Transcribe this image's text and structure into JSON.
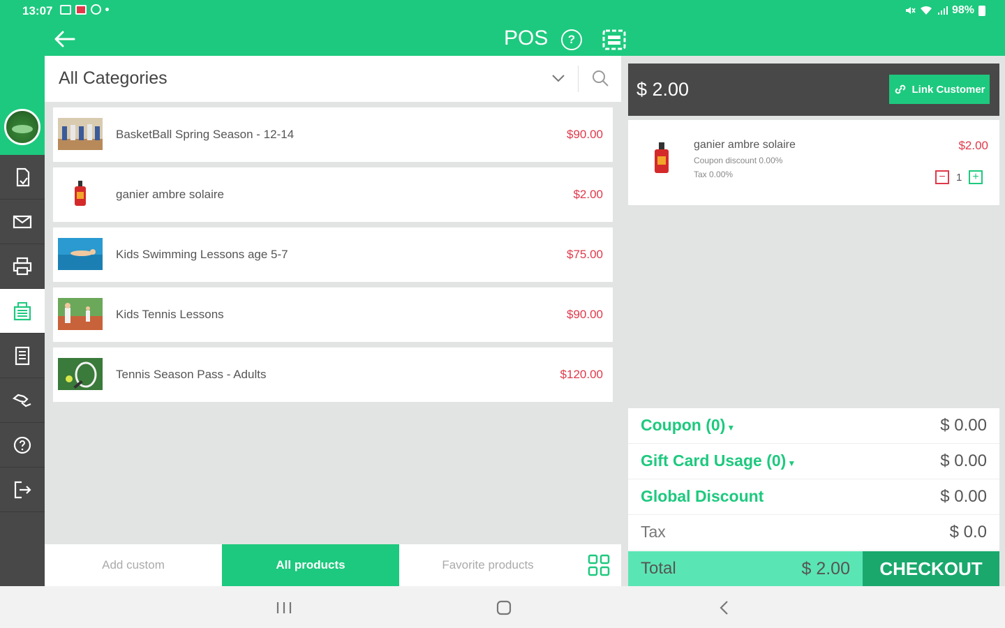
{
  "status_bar": {
    "time": "13:07",
    "battery": "98%"
  },
  "header": {
    "title": "POS",
    "icons": [
      "back-arrow-icon",
      "help-icon",
      "cash-register-icon"
    ],
    "help_glyph": "?"
  },
  "sidebar": {
    "items": [
      {
        "icon": "orders-icon"
      },
      {
        "icon": "mail-icon"
      },
      {
        "icon": "printer-icon"
      },
      {
        "icon": "register-icon",
        "active": true
      },
      {
        "icon": "reports-icon"
      },
      {
        "icon": "payments-icon"
      },
      {
        "icon": "help-icon"
      },
      {
        "icon": "logout-icon"
      }
    ]
  },
  "catalog": {
    "category": "All Categories",
    "products": [
      {
        "name": "BasketBall Spring Season - 12-14",
        "price": "$90.00"
      },
      {
        "name": "ganier ambre solaire",
        "price": "$2.00"
      },
      {
        "name": "Kids Swimming Lessons age 5-7",
        "price": "$75.00"
      },
      {
        "name": "Kids Tennis Lessons",
        "price": "$90.00"
      },
      {
        "name": "Tennis Season Pass - Adults",
        "price": "$120.00"
      }
    ],
    "tabs": {
      "add_custom": "Add custom",
      "all_products": "All products",
      "favorite_products": "Favorite products"
    }
  },
  "cart": {
    "header_total": "$ 2.00",
    "link_customer": "Link Customer",
    "item": {
      "name": "ganier ambre solaire",
      "coupon": "Coupon discount 0.00%",
      "tax": "Tax 0.00%",
      "price": "$2.00",
      "qty": "1",
      "minus": "−",
      "plus": "+"
    },
    "summary": {
      "coupon_label": "Coupon (0)",
      "coupon_value": "$ 0.00",
      "gift_label": "Gift Card Usage (0)",
      "gift_value": "$ 0.00",
      "global_label": "Global Discount",
      "global_value": "$ 0.00",
      "tax_label": "Tax",
      "tax_value": "$ 0.0",
      "total_label": "Total",
      "total_value": "$ 2.00",
      "checkout": "CHECKOUT"
    }
  },
  "colors": {
    "brand_green": "#1dc97e",
    "price_red": "#e0394a",
    "dark_bar": "#484848",
    "total_bar": "#5ae6b4"
  }
}
